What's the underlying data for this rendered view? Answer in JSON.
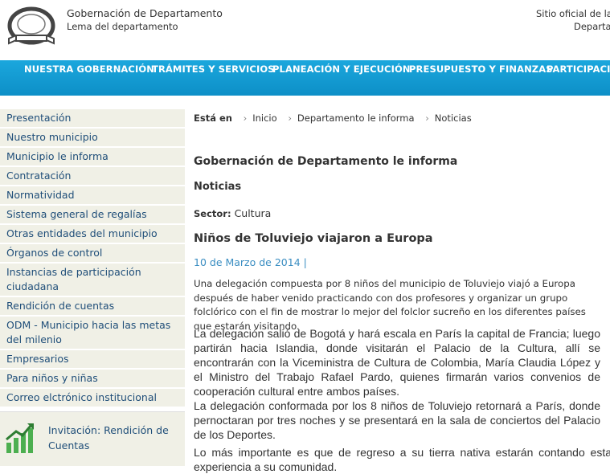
{
  "header": {
    "gov_name": "Gobernación de Departamento",
    "motto": "Lema del departamento",
    "official_line1": "Sitio oficial de la",
    "official_line2": "Departa"
  },
  "nav": {
    "items": [
      "NUESTRA GOBERNACIÓN",
      "TRÁMITES Y SERVICIOS",
      "PLANEACIÓN Y EJECUCIÓN",
      "PRESUPUESTO Y FINANZAS",
      "PARTICIPACI"
    ],
    "bg_color": "#1ba7dd"
  },
  "sidebar": {
    "items": [
      "Presentación",
      "Nuestro municipio",
      "Municipio le informa",
      "Contratación",
      "Normatividad",
      "Sistema general de regalías",
      "Otras entidades del municipio",
      "Órganos de control",
      "Instancias de participación ciudadana",
      "Rendición de cuentas",
      "ODM - Municipio hacia las metas del milenio",
      "Empresarios",
      "Para niños y niñas",
      "Correo elctrónico institucional"
    ],
    "promo": "Invitación: Rendición de Cuentas",
    "promo_icon": "growth-chart-icon"
  },
  "breadcrumb": {
    "label": "Está en",
    "items": [
      "Inicio",
      "Departamento le informa",
      "Noticias"
    ]
  },
  "article": {
    "section_title": "Gobernación de Departamento le informa",
    "subsection": "Noticias",
    "sector_label": "Sector:",
    "sector_value": "Cultura",
    "title": "Niños de Toluviejo viajaron a Europa",
    "date": "10 de Marzo de 2014 |",
    "paragraphs": [
      "Una delegación compuesta por 8 niños del municipio de Toluviejo viajó a Europa después de haber venido practicando con dos profesores y organizar un grupo folclórico con el fin de mostrar lo mejor del folclor sucreño en los diferentes países que estarán visitando.",
      "La delegación salió de Bogotá y hará escala en París la capital de Francia; luego partirán hacia Islandia, donde visitarán el Palacio de la Cultura, allí se encontrarán con la Viceministra de Cultura de Colombia, María Claudia López y el Ministro del Trabajo Rafael Pardo, quienes firmarán varios convenios de cooperación cultural entre ambos países.",
      "La delegación conformada por los 8 niños de Toluviejo retornará a París, donde pernoctaran por tres noches y se presentará en la sala de conciertos del Palacio de los Deportes.",
      "Lo más importante es que de regreso a su tierra nativa estarán contando esta experiencia a su comunidad."
    ]
  }
}
